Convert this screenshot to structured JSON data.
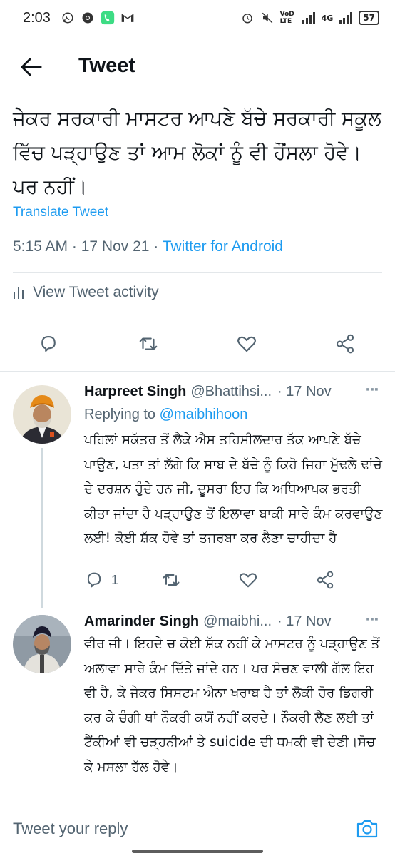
{
  "status_bar": {
    "time": "2:03",
    "network_label": "4G",
    "volte_label": "VoD LTE",
    "battery": "57"
  },
  "header": {
    "title": "Tweet"
  },
  "tweet": {
    "text": "ਜੇਕਰ ਸਰਕਾਰੀ ਮਾਸਟਰ ਆਪਣੇ ਬੱਚੇ ਸਰਕਾਰੀ ਸਕੂਲ ਵਿੱਚ ਪੜ੍ਹਾਉਣ ਤਾਂ ਆਮ ਲੋਕਾਂ ਨੂੰ ਵੀ ਹੌਂਸਲਾ ਹੋਵੇ। ਪਰ ਨਹੀਂ।",
    "translate_label": "Translate Tweet",
    "timestamp": "5:15 AM · 17 Nov 21 · ",
    "source": "Twitter for Android",
    "activity_label": "View Tweet activity"
  },
  "replies": [
    {
      "name": "Harpreet Singh",
      "handle": "@Bhattihsi...",
      "date": "· 17 Nov",
      "replying_prefix": "Replying to ",
      "replying_to": "@maibhihoon",
      "text": "ਪਹਿਲਾਂ ਸਕੱਤਰ ਤੋਂ ਲੈਕੇ ਐਸ ਤਹਿਸੀਲਦਾਰ ਤੱਕ ਆਪਣੇ ਬੱਚੇ ਪਾਉਣ, ਪਤਾ ਤਾਂ ਲੱਗੇ ਕਿ ਸਾਬ ਦੇ ਬੱਚੇ ਨੂੰ ਕਿਹੋ ਜਿਹਾ ਮੁੱਢਲੇ ਢਾਂਚੇ ਦੇ ਦਰਸ਼ਨ ਹੁੰਦੇ ਹਨ ਜੀ, ਦੂਸਰਾ ਇਹ ਕਿ ਅਧਿਆਪਕ ਭਰਤੀ ਕੀਤਾ ਜਾਂਦਾ ਹੈ ਪੜ੍ਹਾਉਣ ਤੋਂ ਇਲਾਵਾ ਬਾਕੀ ਸਾਰੇ ਕੰਮ ਕਰਵਾਉਣ ਲਈ! ਕੋਈ ਸ਼ੱਕ ਹੋਵੇ ਤਾਂ ਤਜਰਬਾ ਕਰ ਲੈਣਾ ਚਾਹੀਦਾ ਹੈ",
      "reply_count": "1"
    },
    {
      "name": "Amarinder Singh",
      "handle": "@maibhi...",
      "date": "· 17 Nov",
      "text": "ਵੀਰ ਜੀ। ਇਹਦੇ ਚ ਕੋਈ ਸ਼ੱਕ ਨਹੀਂ ਕੇ ਮਾਸਟਰ ਨੂੰ ਪੜ੍ਹਾਉਣ ਤੋਂ ਅਲਾਵਾ ਸਾਰੇ ਕੰਮ ਦਿੱਤੇ ਜਾਂਦੇ ਹਨ। ਪਰ ਸੋਚਣ ਵਾਲੀ ਗੱਲ ਇਹ ਵੀ ਹੈ, ਕੇ ਜੇਕਰ ਸਿਸਟਮ ਐਨਾ ਖਰਾਬ ਹੈ ਤਾਂ ਲੋਕੀ ਹੋਰ ਡਿਗਰੀ ਕਰ ਕੇ ਚੰਗੀ ਥਾਂ ਨੌਕਰੀ ਕਯੋਂ ਨਹੀਂ ਕਰਦੇ। ਨੌਕਰੀ ਲੈਣ ਲਈ ਤਾਂ ਟੈਂਕੀਆਂ ਵੀ ਚੜ੍ਹਨੀਆਂ ਤੇ suicide ਦੀ ਧਮਕੀ ਵੀ ਦੇਣੀ।ਸੋਚ ਕੇ ਮਸਲਾ ਹੱਲ ਹੋਵੇ।"
    }
  ],
  "composer": {
    "placeholder": "Tweet your reply"
  },
  "colors": {
    "accent": "#1d9bf0",
    "secondary_text": "#536471",
    "primary_text": "#0f1419",
    "divider": "#e3e7ea"
  },
  "icons": {
    "back": "arrow-left-icon",
    "reply": "comment-bubble-icon",
    "retweet": "retweet-icon",
    "like": "heart-icon",
    "share": "share-icon",
    "activity": "bar-chart-icon",
    "camera": "camera-icon"
  }
}
